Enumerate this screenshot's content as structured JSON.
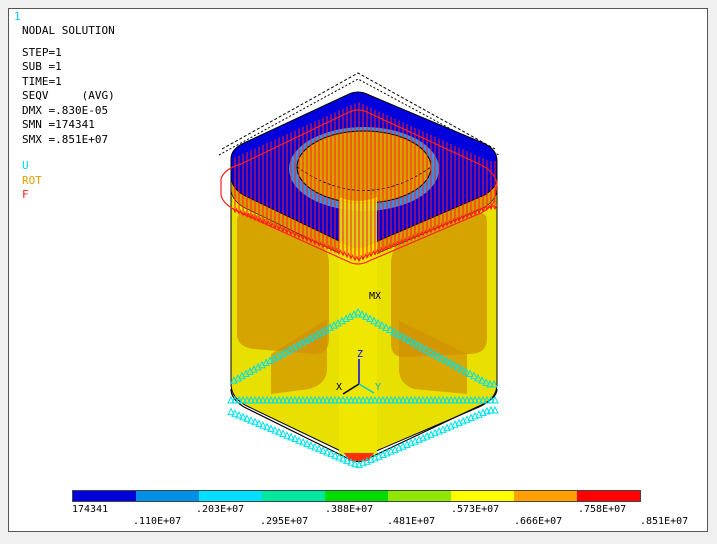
{
  "window_number": "1",
  "title": "NODAL SOLUTION",
  "info_lines": [
    "STEP=1",
    "SUB =1",
    "TIME=1",
    "SEQV     (AVG)",
    "DMX =.830E-05",
    "SMN =174341",
    "SMX =.851E+07"
  ],
  "legend": {
    "u": "U",
    "rot": "ROT",
    "f": "F"
  },
  "mx_label": "MX",
  "triad": {
    "z": "Z",
    "x": "X",
    "y": "Y"
  },
  "colorbar": {
    "colors": [
      "#0000dd",
      "#0090e8",
      "#00e0ff",
      "#00e8a0",
      "#00dd00",
      "#90e800",
      "#ffff00",
      "#ffa000",
      "#ff0000"
    ],
    "labels_top_row": [
      "174341",
      ".203E+07",
      ".388E+07",
      ".573E+07",
      ".758E+07"
    ],
    "labels_bottom_row": [
      ".110E+07",
      ".295E+07",
      ".481E+07",
      ".666E+07",
      ".851E+07"
    ]
  }
}
